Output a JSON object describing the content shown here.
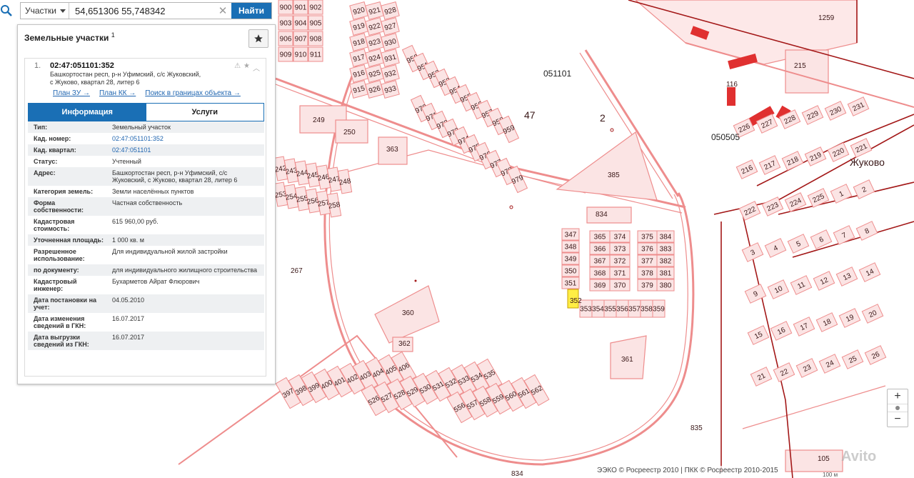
{
  "search": {
    "type_label": "Участки",
    "query": "54,651306 55,748342",
    "button": "Найти"
  },
  "panel": {
    "title": "Земельные участки",
    "count": "1",
    "parcel": {
      "index": "1.",
      "id": "02:47:051101:352",
      "address_line1": "Башкортостан респ, р-н Уфимский, с/с Жуковский,",
      "address_line2": "с Жуково, квартал 28, литер 6",
      "links": [
        "План ЗУ →",
        "План КК →",
        "Поиск в границах объекта →"
      ]
    },
    "tabs": [
      "Информация",
      "Услуги"
    ],
    "info": [
      {
        "k": "Тип:",
        "v": "Земельный участок",
        "link": false
      },
      {
        "k": "Кад. номер:",
        "v": "02:47:051101:352",
        "link": true
      },
      {
        "k": "Кад. квартал:",
        "v": "02:47:051101",
        "link": true
      },
      {
        "k": "Статус:",
        "v": "Учтенный",
        "link": false
      },
      {
        "k": "Адрес:",
        "v": "Башкортостан респ, р-н Уфимский, с/с Жуковский, с Жуково, квартал 28, литер 6",
        "link": false
      },
      {
        "k": "Категория земель:",
        "v": "Земли населённых пунктов",
        "link": false
      },
      {
        "k": "Форма собственности:",
        "v": "Частная собственность",
        "link": false
      },
      {
        "k": "Кадастровая стоимость:",
        "v": "615 960,00 руб.",
        "link": false
      },
      {
        "k": "Уточненная площадь:",
        "v": "1 000 кв. м",
        "link": false
      },
      {
        "k": "Разрешенное использование:",
        "v": "Для индивидуальной жилой застройки",
        "link": false
      },
      {
        "k": "по документу:",
        "v": "для индивидуального жилищного строительства",
        "link": false
      },
      {
        "k": "Кадастровый инженер:",
        "v": "Бухарметов Айрат Флюрович",
        "link": false
      },
      {
        "k": "Дата постановки на учет:",
        "v": "04.05.2010",
        "link": false
      },
      {
        "k": "Дата изменения сведений в ГКН:",
        "v": "16.07.2017",
        "link": false
      },
      {
        "k": "Дата выгрузки сведений из ГКН:",
        "v": "16.07.2017",
        "link": false
      }
    ]
  },
  "map": {
    "colors": {
      "parcel_line": "#ee8d8d",
      "parcel_fill": "#fbe4e4",
      "boundary_line": "#a31818",
      "building": "#e03030",
      "selected": "#ffee44"
    },
    "labels": {
      "quarter_051101": "051101",
      "quarter_050505": "050505",
      "settlement": "Жуково",
      "big_2": "2",
      "big_47": "47",
      "p249": "249",
      "p250": "250",
      "p363": "363",
      "p385": "385",
      "p834": "834",
      "p267": "267",
      "p360": "360",
      "p362": "362",
      "p361": "361",
      "p835": "835",
      "p834b": "834",
      "p1259": "1259",
      "p215": "215",
      "p116": "116",
      "p105": "105",
      "selected": "352"
    },
    "grid_small": {
      "c1": [
        "347",
        "348",
        "349",
        "350",
        "351"
      ],
      "c2": [
        "365",
        "366",
        "367",
        "368",
        "369"
      ],
      "c3": [
        "374",
        "373",
        "372",
        "371",
        "370"
      ],
      "c4": [
        "375",
        "376",
        "377",
        "378",
        "379"
      ],
      "c5": [
        "384",
        "383",
        "382",
        "381",
        "380"
      ],
      "bottom": [
        "353",
        "354",
        "355",
        "356",
        "357",
        "358",
        "359"
      ]
    },
    "block_a": [
      [
        "920",
        "919",
        "918",
        "917",
        "916",
        "915"
      ],
      [
        "921",
        "922",
        "923",
        "924",
        "925",
        "926"
      ],
      [
        "928",
        "927",
        "930",
        "931",
        "932",
        "933"
      ]
    ],
    "block_b": [
      [
        "950",
        "951",
        "952",
        "953",
        "954",
        "955",
        "956",
        "957",
        "958",
        "959"
      ],
      [
        "970",
        "971",
        "972",
        "973",
        "974",
        "975",
        "976",
        "977",
        "978",
        "979"
      ]
    ],
    "block_c": [
      "900",
      "901",
      "902",
      "903",
      "904",
      "905",
      "906",
      "907",
      "908",
      "909",
      "910",
      "911"
    ],
    "block_d": [
      [
        "397",
        "398",
        "399",
        "400",
        "401",
        "402",
        "403",
        "404",
        "405",
        "406"
      ],
      [
        "526",
        "527",
        "528",
        "529",
        "530",
        "531",
        "532",
        "533",
        "534",
        "535"
      ],
      [
        "556",
        "557",
        "558",
        "559",
        "560",
        "561",
        "562"
      ]
    ],
    "left_strip": [
      "242",
      "243",
      "244",
      "245",
      "246",
      "247",
      "248",
      "253",
      "254",
      "255",
      "256",
      "257",
      "258"
    ],
    "right_nums": [
      "226",
      "227",
      "228",
      "229",
      "230",
      "231",
      "216",
      "217",
      "218",
      "219",
      "220",
      "221",
      "222",
      "223",
      "224",
      "225",
      "1",
      "2",
      "3",
      "4",
      "5",
      "6",
      "7",
      "8",
      "9",
      "10",
      "11",
      "12",
      "13",
      "14",
      "15",
      "16",
      "17",
      "18",
      "19",
      "20",
      "21",
      "22",
      "23",
      "24",
      "25",
      "26"
    ],
    "attribution": "ЭЭКО © Росреестр 2010 | ПКК © Росреестр 2010-2015",
    "scale": "100 м",
    "watermark": "Avito"
  }
}
